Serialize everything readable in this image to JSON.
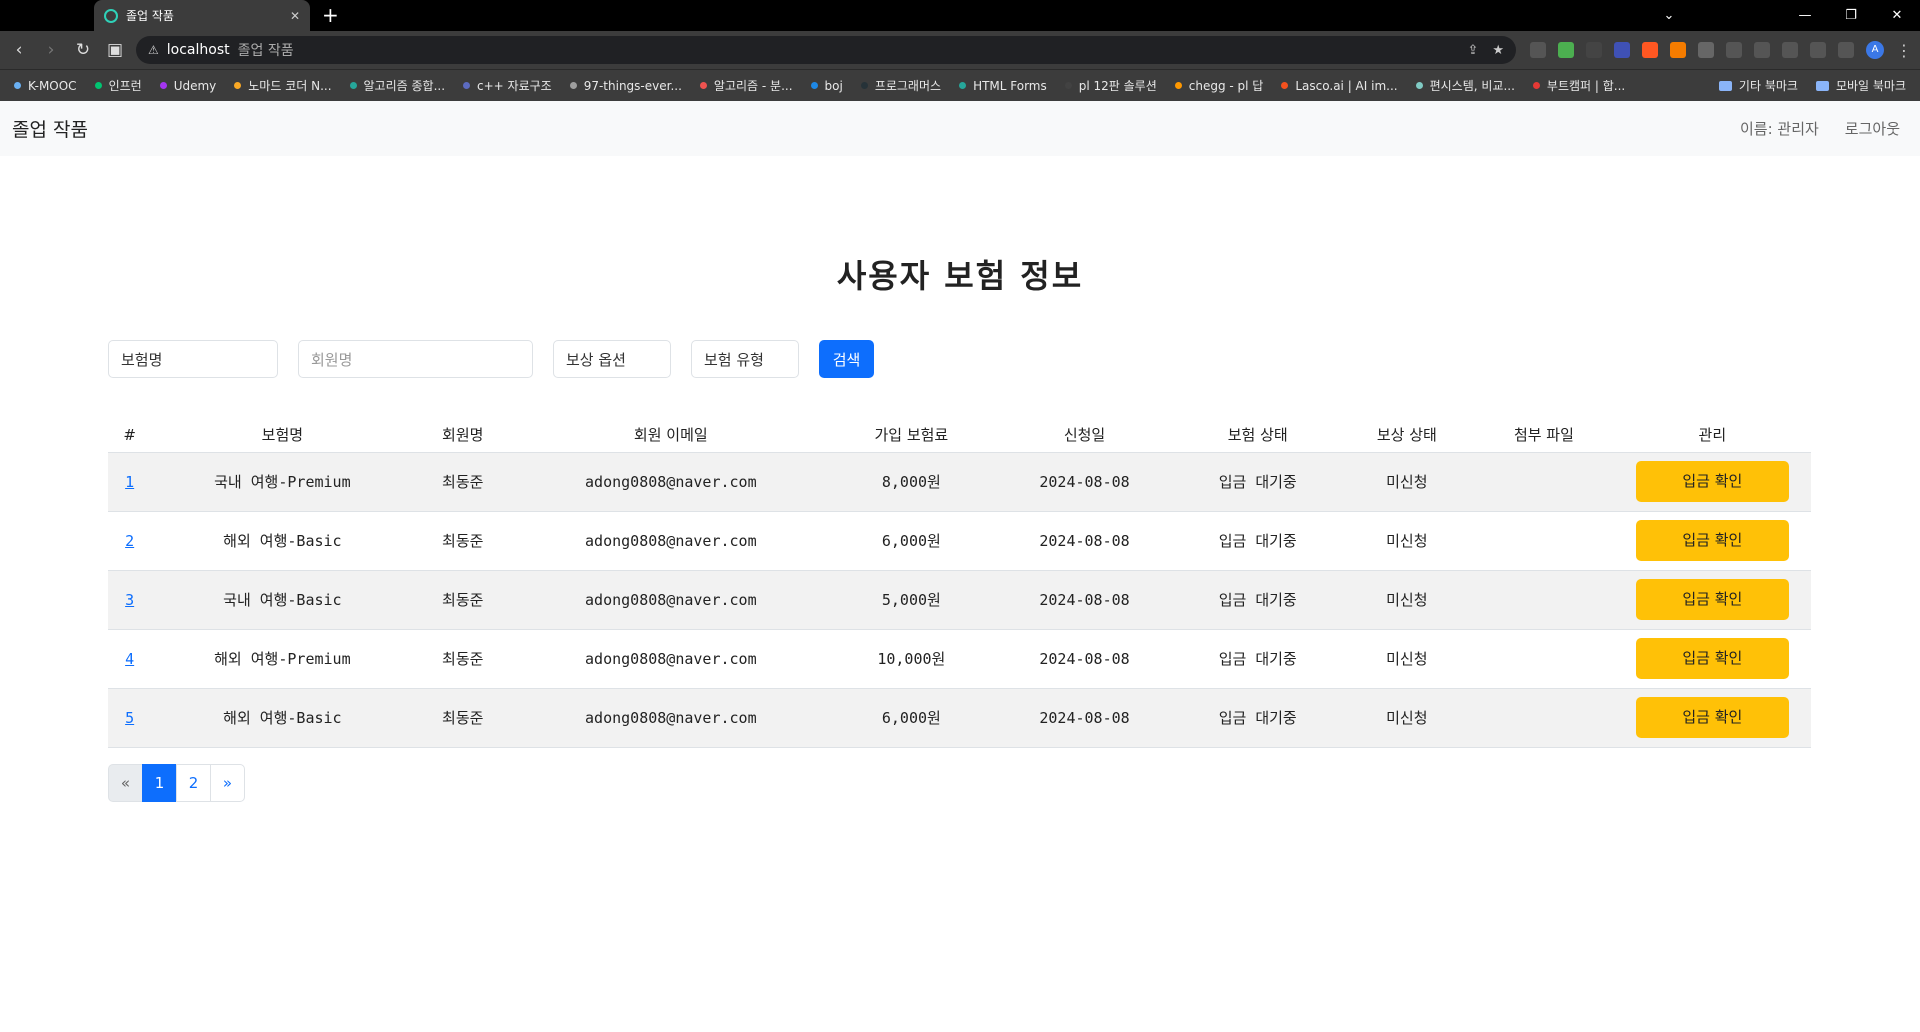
{
  "browser": {
    "tab_title": "졸업 작품",
    "address_host": "localhost",
    "address_path": "졸업 작품",
    "bookmarks": [
      {
        "label": "K-MOOC",
        "color": "#6ab0f3"
      },
      {
        "label": "인프런",
        "color": "#00c471"
      },
      {
        "label": "Udemy",
        "color": "#a435f0"
      },
      {
        "label": "노마드 코더 N...",
        "color": "#f9a825"
      },
      {
        "label": "알고리즘 종합...",
        "color": "#26a69a"
      },
      {
        "label": "c++ 자료구조",
        "color": "#5c6bc0"
      },
      {
        "label": "97-things-ever...",
        "color": "#9e9e9e"
      },
      {
        "label": "알고리즘 - 분...",
        "color": "#ef5350"
      },
      {
        "label": "boj",
        "color": "#1e88e5"
      },
      {
        "label": "프로그래머스",
        "color": "#263238"
      },
      {
        "label": "HTML Forms",
        "color": "#26a69a"
      },
      {
        "label": "pl 12판 솔루션",
        "color": "#424242"
      },
      {
        "label": "chegg - pl 답",
        "color": "#ff9800"
      },
      {
        "label": "Lasco.ai | AI im...",
        "color": "#f4511e"
      },
      {
        "label": "편시스템, 비교...",
        "color": "#80cbc4"
      },
      {
        "label": "부트캠퍼 | 합...",
        "color": "#e53935"
      }
    ],
    "bookmark_folders": [
      "기타 북마크",
      "모바일 북마크"
    ]
  },
  "header": {
    "brand": "졸업 작품",
    "user_label": "이름: 관리자",
    "logout": "로그아웃"
  },
  "main": {
    "title": "사용자 보험 정보",
    "search": {
      "insurance_name": "보험명",
      "member_name_placeholder": "회원명",
      "compensation_option": "보상 옵션",
      "insurance_type": "보험 유형",
      "search_button": "검색"
    },
    "table": {
      "headers": [
        "#",
        "보험명",
        "회원명",
        "회원 이메일",
        "가입 보험료",
        "신청일",
        "보험 상태",
        "보상 상태",
        "첨부 파일",
        "관리"
      ],
      "rows": [
        {
          "id": "1",
          "name": "국내 여행-Premium",
          "member": "최동준",
          "email": "adong0808@naver.com",
          "fee": "8,000원",
          "date": "2024-08-08",
          "status": "입금 대기중",
          "comp": "미신청",
          "file": "",
          "action": "입금 확인"
        },
        {
          "id": "2",
          "name": "해외 여행-Basic",
          "member": "최동준",
          "email": "adong0808@naver.com",
          "fee": "6,000원",
          "date": "2024-08-08",
          "status": "입금 대기중",
          "comp": "미신청",
          "file": "",
          "action": "입금 확인"
        },
        {
          "id": "3",
          "name": "국내 여행-Basic",
          "member": "최동준",
          "email": "adong0808@naver.com",
          "fee": "5,000원",
          "date": "2024-08-08",
          "status": "입금 대기중",
          "comp": "미신청",
          "file": "",
          "action": "입금 확인"
        },
        {
          "id": "4",
          "name": "해외 여행-Premium",
          "member": "최동준",
          "email": "adong0808@naver.com",
          "fee": "10,000원",
          "date": "2024-08-08",
          "status": "입금 대기중",
          "comp": "미신청",
          "file": "",
          "action": "입금 확인"
        },
        {
          "id": "5",
          "name": "해외 여행-Basic",
          "member": "최동준",
          "email": "adong0808@naver.com",
          "fee": "6,000원",
          "date": "2024-08-08",
          "status": "입금 대기중",
          "comp": "미신청",
          "file": "",
          "action": "입금 확인"
        }
      ]
    },
    "pagination": {
      "prev": "«",
      "pages": [
        "1",
        "2"
      ],
      "current": "1",
      "next": "»"
    }
  }
}
